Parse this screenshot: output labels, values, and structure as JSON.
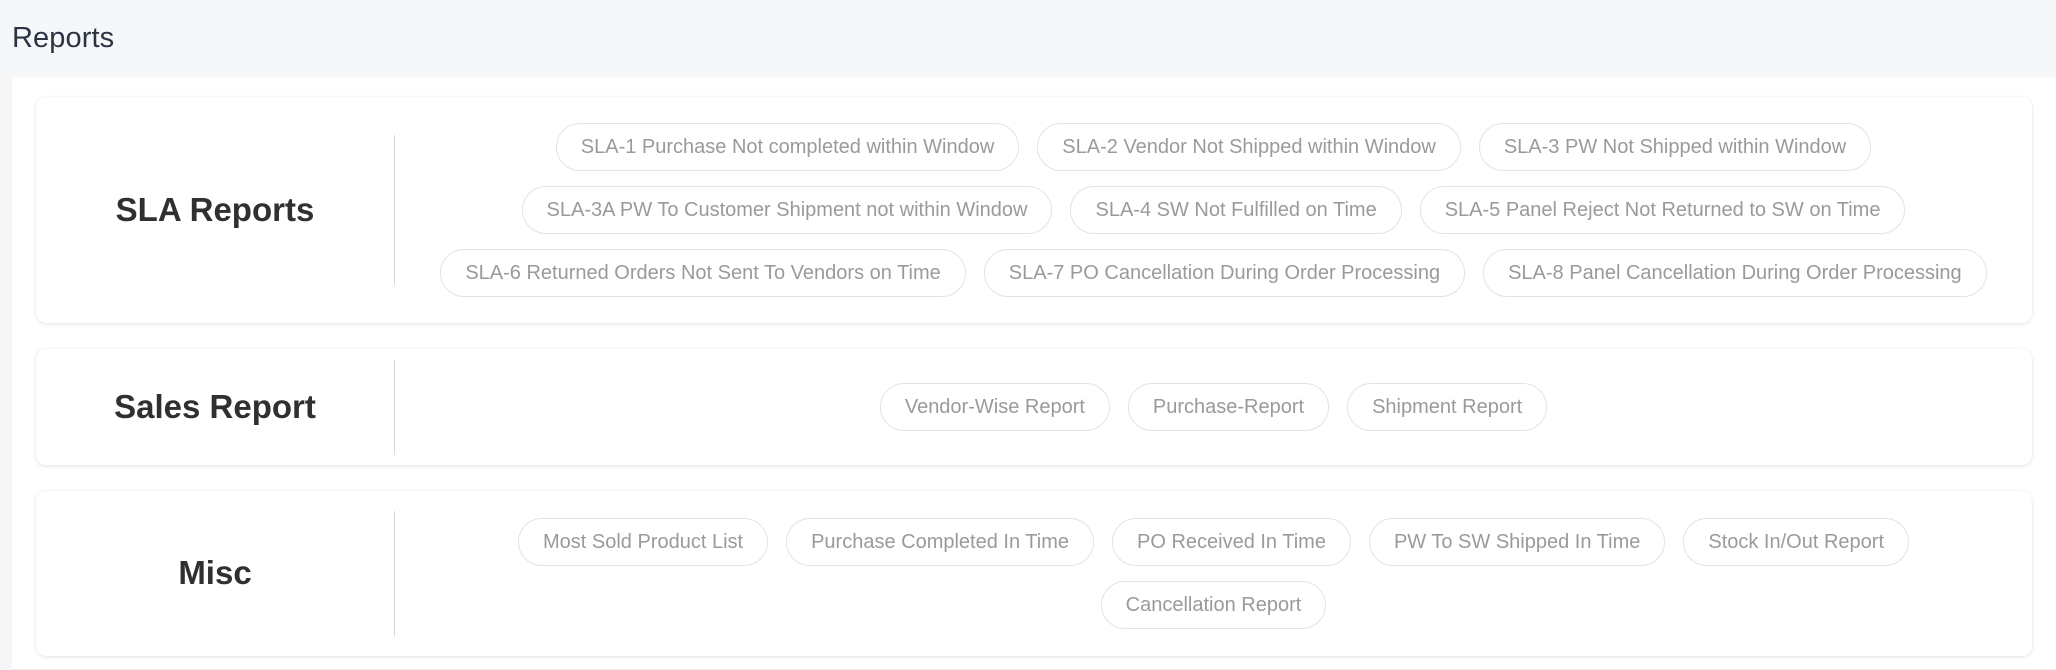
{
  "header": {
    "title": "Reports"
  },
  "colors": {
    "page_background": "#f5f6f7",
    "card_background": "#ffffff",
    "title_text": "#303030",
    "header_text": "#2b3445",
    "chip_text": "#9a9a9a",
    "chip_border": "#e3e3e3",
    "divider": "#d8d8d8"
  },
  "sections": [
    {
      "title": "SLA Reports",
      "chips": [
        "SLA-1 Purchase Not completed within Window",
        "SLA-2 Vendor Not Shipped within Window",
        "SLA-3 PW Not Shipped within Window",
        "SLA-3A PW To Customer Shipment not within Window",
        "SLA-4 SW Not Fulfilled on Time",
        "SLA-5 Panel Reject Not Returned to SW on Time",
        "SLA-6 Returned Orders Not Sent To Vendors on Time",
        "SLA-7 PO Cancellation During Order Processing",
        "SLA-8 Panel Cancellation During Order Processing"
      ]
    },
    {
      "title": "Sales Report",
      "chips": [
        "Vendor-Wise Report",
        "Purchase-Report",
        "Shipment Report"
      ]
    },
    {
      "title": "Misc",
      "chips": [
        "Most Sold Product List",
        "Purchase Completed In Time",
        "PO Received In Time",
        "PW To SW Shipped In Time",
        "Stock In/Out Report",
        "Cancellation Report"
      ]
    }
  ]
}
